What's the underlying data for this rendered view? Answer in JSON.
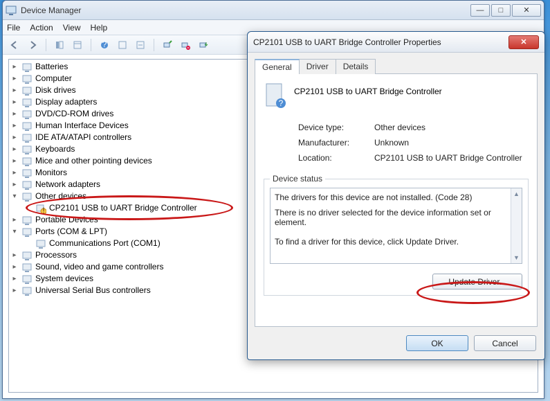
{
  "window": {
    "title": "Device Manager",
    "menus": [
      "File",
      "Action",
      "View",
      "Help"
    ]
  },
  "tree": {
    "items": [
      {
        "label": "Batteries"
      },
      {
        "label": "Computer"
      },
      {
        "label": "Disk drives"
      },
      {
        "label": "Display adapters"
      },
      {
        "label": "DVD/CD-ROM drives"
      },
      {
        "label": "Human Interface Devices"
      },
      {
        "label": "IDE ATA/ATAPI controllers"
      },
      {
        "label": "Keyboards"
      },
      {
        "label": "Mice and other pointing devices"
      },
      {
        "label": "Monitors"
      },
      {
        "label": "Network adapters"
      },
      {
        "label": "Other devices",
        "expanded": true,
        "children": [
          {
            "label": "CP2101 USB to UART Bridge Controller",
            "warn": true
          }
        ]
      },
      {
        "label": "Portable Devices"
      },
      {
        "label": "Ports (COM & LPT)",
        "expanded": true,
        "children": [
          {
            "label": "Communications Port (COM1)"
          }
        ]
      },
      {
        "label": "Processors"
      },
      {
        "label": "Sound, video and game controllers"
      },
      {
        "label": "System devices"
      },
      {
        "label": "Universal Serial Bus controllers"
      }
    ]
  },
  "dialog": {
    "title": "CP2101 USB to UART Bridge Controller Properties",
    "tabs": [
      "General",
      "Driver",
      "Details"
    ],
    "device_name": "CP2101 USB to UART Bridge Controller",
    "rows": {
      "type_label": "Device type:",
      "type_value": "Other devices",
      "mfr_label": "Manufacturer:",
      "mfr_value": "Unknown",
      "loc_label": "Location:",
      "loc_value": "CP2101 USB to UART Bridge Controller"
    },
    "status": {
      "legend": "Device status",
      "line1": "The drivers for this device are not installed. (Code 28)",
      "line2": "There is no driver selected for the device information set or element.",
      "line3": "To find a driver for this device, click Update Driver."
    },
    "buttons": {
      "update": "Update Driver...",
      "ok": "OK",
      "cancel": "Cancel"
    }
  }
}
